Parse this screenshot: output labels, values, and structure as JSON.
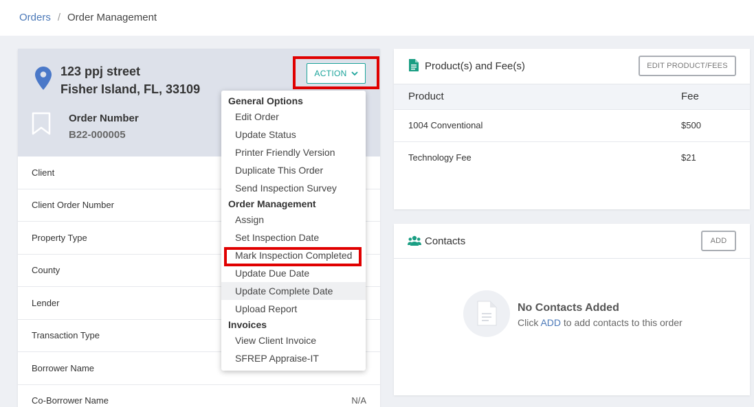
{
  "breadcrumb": {
    "link": "Orders",
    "separator": "/",
    "current": "Order Management"
  },
  "order": {
    "address_line1": "123 ppj street",
    "address_line2": "Fisher Island, FL, 33109",
    "number_label": "Order Number",
    "number_value": "B22-000005",
    "action_label": "ACTION"
  },
  "details": [
    {
      "label": "Client",
      "value": ""
    },
    {
      "label": "Client Order Number",
      "value": ""
    },
    {
      "label": "Property Type",
      "value": ""
    },
    {
      "label": "County",
      "value": ""
    },
    {
      "label": "Lender",
      "value": ""
    },
    {
      "label": "Transaction Type",
      "value": ""
    },
    {
      "label": "Borrower Name",
      "value": ""
    },
    {
      "label": "Co-Borrower Name",
      "value": "N/A"
    }
  ],
  "menu": {
    "group1": "General Options",
    "group1_items": [
      "Edit Order",
      "Update Status",
      "Printer Friendly Version",
      "Duplicate This Order",
      "Send Inspection Survey"
    ],
    "group2": "Order Management",
    "group2_items": [
      "Assign",
      "Set Inspection Date",
      "Mark Inspection Completed",
      "Update Due Date",
      "Update Complete Date",
      "Upload Report"
    ],
    "group3": "Invoices",
    "group3_items": [
      "View Client Invoice",
      "SFREP Appraise-IT"
    ]
  },
  "products": {
    "title": "Product(s) and Fee(s)",
    "edit_button": "EDIT PRODUCT/FEES",
    "col_product": "Product",
    "col_fee": "Fee",
    "rows": [
      {
        "product": "1004 Conventional",
        "fee": "$500"
      },
      {
        "product": "Technology Fee",
        "fee": "$21"
      }
    ]
  },
  "contacts": {
    "title": "Contacts",
    "add_button": "ADD",
    "empty_title": "No Contacts Added",
    "empty_prefix": "Click",
    "empty_link": "ADD",
    "empty_suffix": "to add contacts to this order"
  },
  "colors": {
    "accent": "#1aa39a",
    "link": "#4a78b8",
    "highlight": "#e00000"
  }
}
